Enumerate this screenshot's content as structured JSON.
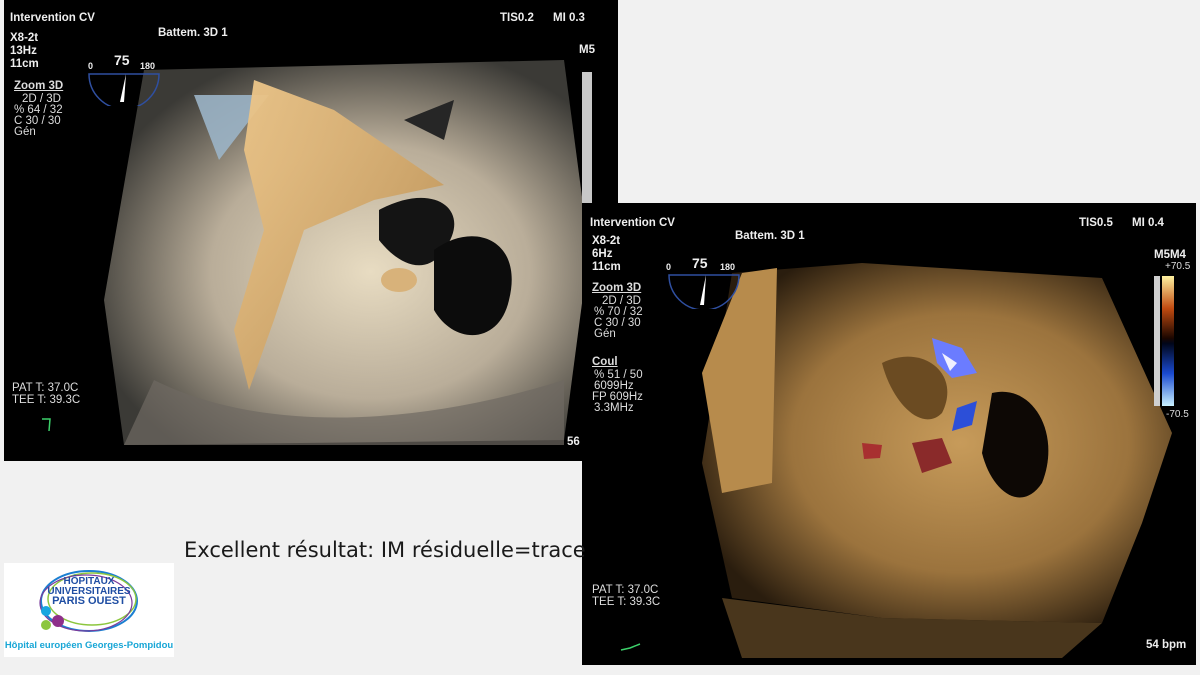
{
  "panel1": {
    "overlay": {
      "site": "Intervention CV",
      "probe": "X8-2t",
      "rate": "13Hz",
      "depth": "11cm",
      "mode_title": "Battem. 3D 1",
      "tis": "TIS0.2",
      "mi": "MI 0.3",
      "map_label": "M5",
      "angle_min": "0",
      "angle_value": "75",
      "angle_max": "180",
      "zoom_title": "Zoom 3D",
      "zoom_lines": [
        "2D / 3D",
        "% 64 / 32",
        "C 30 / 30",
        "Gén"
      ],
      "pat_t": "PAT T: 37.0C",
      "tee_t": "TEE T: 39.3C",
      "bpm": "56"
    }
  },
  "panel2": {
    "overlay": {
      "site": "Intervention CV",
      "probe": "X8-2t",
      "rate": "6Hz",
      "depth": "11cm",
      "mode_title": "Battem. 3D 1",
      "tis": "TIS0.5",
      "mi": "MI 0.4",
      "map_label": "M5M4",
      "scale_top": "+70.5",
      "scale_bottom": "-70.5",
      "angle_min": "0",
      "angle_value": "75",
      "angle_max": "180",
      "zoom_title": "Zoom 3D",
      "zoom_lines": [
        "2D / 3D",
        "% 70 / 32",
        "C 30 / 30",
        "Gén"
      ],
      "color_title": "Coul",
      "color_lines": [
        "% 51 / 50",
        "6099Hz",
        "FP 609Hz",
        "3.3MHz"
      ],
      "pat_t": "PAT T: 37.0C",
      "tee_t": "TEE T: 39.3C",
      "bpm": "54 bpm"
    }
  },
  "caption": "Excellent résultat: IM résiduelle=trace",
  "logo": {
    "line1": "HÔPITAUX",
    "line2": "UNIVERSITAIRES",
    "line3": "PARIS OUEST",
    "line4": "Hôpital européen Georges-Pompidou"
  }
}
